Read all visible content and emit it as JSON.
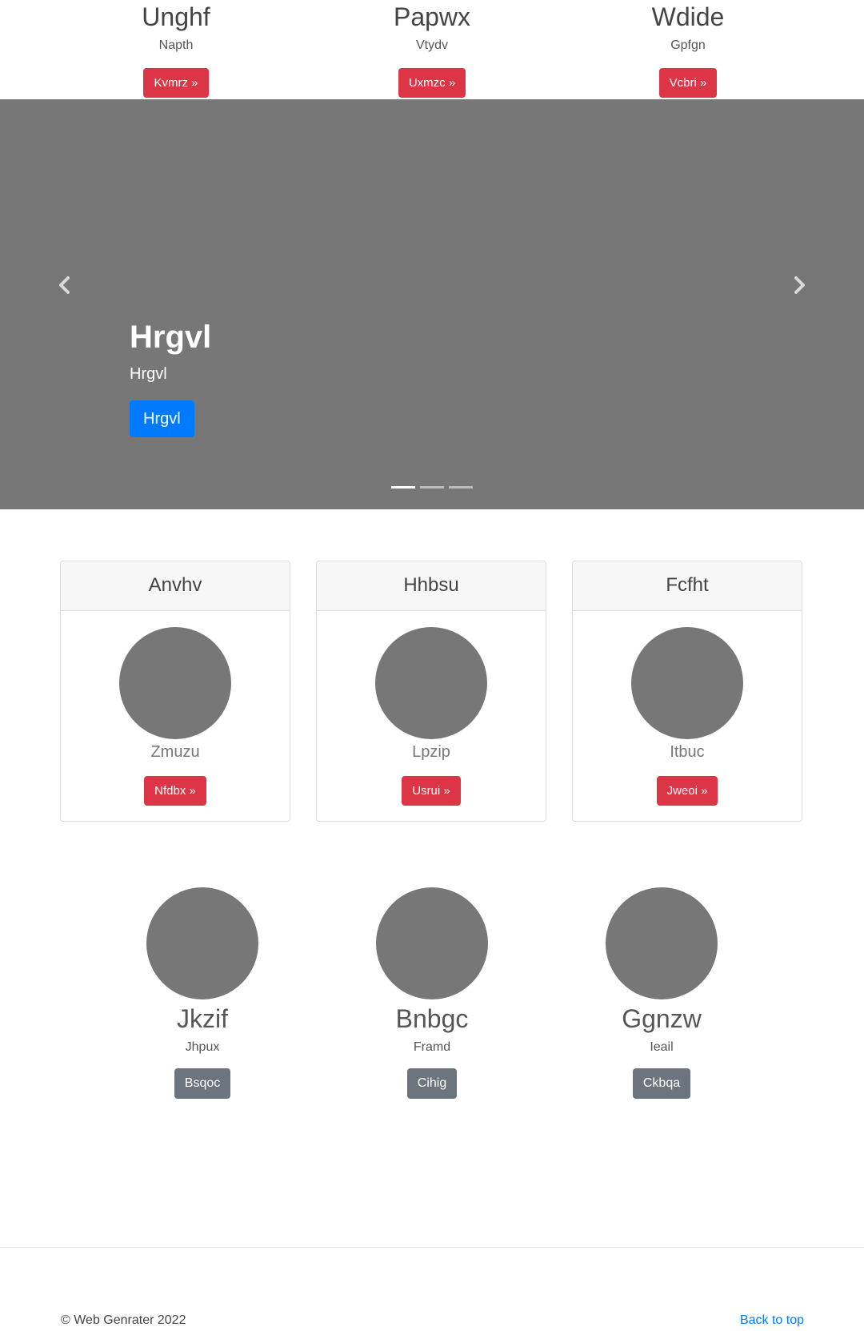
{
  "features": [
    {
      "title": "Unghf",
      "subtitle": "Napth",
      "button": "Kvmrz »"
    },
    {
      "title": "Papwx",
      "subtitle": "Vtydv",
      "button": "Uxmzc »"
    },
    {
      "title": "Wdide",
      "subtitle": "Gpfgn",
      "button": "Vcbri »"
    }
  ],
  "carousel": {
    "title": "Hrgvl",
    "subtitle": "Hrgvl",
    "button": "Hrgvl",
    "prev_icon": "chevron-left-icon",
    "next_icon": "chevron-right-icon",
    "active_slide": 1,
    "slide_count": 3
  },
  "cards": [
    {
      "header": "Anvhv",
      "caption": "Zmuzu",
      "button": "Nfdbx »"
    },
    {
      "header": "Hhbsu",
      "caption": "Lpzip",
      "button": "Usrui »"
    },
    {
      "header": "Fcfht",
      "caption": "Itbuc",
      "button": "Jweoi »"
    }
  ],
  "columns": [
    {
      "title": "Jkzif",
      "subtitle": "Jhpux",
      "button": "Bsqoc"
    },
    {
      "title": "Bnbgc",
      "subtitle": "Framd",
      "button": "Cihig"
    },
    {
      "title": "Ggnzw",
      "subtitle": "Ieail",
      "button": "Ckbqa"
    }
  ],
  "footer": {
    "copyright": "© Web Genrater 2022",
    "back_to_top": "Back to top"
  },
  "colors": {
    "danger": "#dc3545",
    "primary": "#007bff",
    "secondary": "#6c757d",
    "placeholder": "#777777"
  }
}
